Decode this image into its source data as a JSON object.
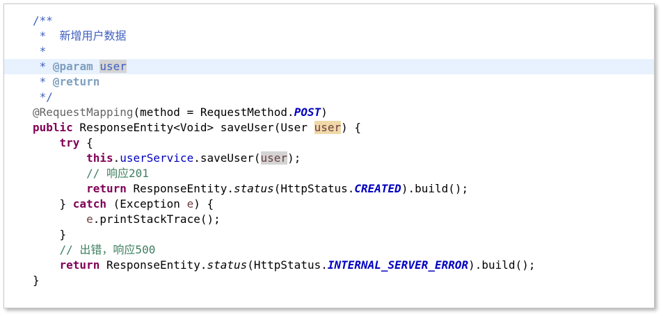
{
  "editor": {
    "lines": [
      {
        "tokens": [
          {
            "t": "/**",
            "c": "jd"
          }
        ]
      },
      {
        "tokens": [
          {
            "t": " *  新增用户数据",
            "c": "jd"
          }
        ]
      },
      {
        "tokens": [
          {
            "t": " *",
            "c": "jd"
          }
        ]
      },
      {
        "current": true,
        "tokens": [
          {
            "t": " * ",
            "c": "jd"
          },
          {
            "t": "@param",
            "c": "jdtag"
          },
          {
            "t": " ",
            "c": "jd"
          },
          {
            "t": "user",
            "c": "jd hl-gray"
          }
        ]
      },
      {
        "tokens": [
          {
            "t": " * ",
            "c": "jd"
          },
          {
            "t": "@return",
            "c": "jdtag"
          }
        ]
      },
      {
        "tokens": [
          {
            "t": " */",
            "c": "jd"
          }
        ]
      },
      {
        "tokens": [
          {
            "t": "@RequestMapping",
            "c": "ann"
          },
          {
            "t": "(method = RequestMethod.",
            "c": ""
          },
          {
            "t": "POST",
            "c": "cst"
          },
          {
            "t": ")",
            "c": ""
          }
        ]
      },
      {
        "tokens": [
          {
            "t": "public",
            "c": "kw"
          },
          {
            "t": " ResponseEntity<Void> saveUser(User ",
            "c": ""
          },
          {
            "t": "user",
            "c": "var hl-orange"
          },
          {
            "t": ") {",
            "c": ""
          }
        ]
      },
      {
        "tokens": [
          {
            "t": "    ",
            "c": ""
          },
          {
            "t": "try",
            "c": "kw"
          },
          {
            "t": " {",
            "c": ""
          }
        ]
      },
      {
        "tokens": [
          {
            "t": "        ",
            "c": ""
          },
          {
            "t": "this",
            "c": "kw"
          },
          {
            "t": ".",
            "c": ""
          },
          {
            "t": "userService",
            "c": "fld"
          },
          {
            "t": ".saveUser(",
            "c": ""
          },
          {
            "t": "user",
            "c": "var hl-gray"
          },
          {
            "t": ");",
            "c": ""
          }
        ]
      },
      {
        "tokens": [
          {
            "t": "        ",
            "c": ""
          },
          {
            "t": "// 响应201",
            "c": "cm"
          }
        ]
      },
      {
        "tokens": [
          {
            "t": "        ",
            "c": ""
          },
          {
            "t": "return",
            "c": "kw"
          },
          {
            "t": " ResponseEntity.",
            "c": ""
          },
          {
            "t": "status",
            "c": "st"
          },
          {
            "t": "(HttpStatus.",
            "c": ""
          },
          {
            "t": "CREATED",
            "c": "cst"
          },
          {
            "t": ").build();",
            "c": ""
          }
        ]
      },
      {
        "tokens": [
          {
            "t": "    } ",
            "c": ""
          },
          {
            "t": "catch",
            "c": "kw"
          },
          {
            "t": " (Exception ",
            "c": ""
          },
          {
            "t": "e",
            "c": "var"
          },
          {
            "t": ") {",
            "c": ""
          }
        ]
      },
      {
        "tokens": [
          {
            "t": "        ",
            "c": ""
          },
          {
            "t": "e",
            "c": "var"
          },
          {
            "t": ".printStackTrace();",
            "c": ""
          }
        ]
      },
      {
        "tokens": [
          {
            "t": "    }",
            "c": ""
          }
        ]
      },
      {
        "tokens": [
          {
            "t": "    ",
            "c": ""
          },
          {
            "t": "// 出错，响应500",
            "c": "cm"
          }
        ]
      },
      {
        "tokens": [
          {
            "t": "    ",
            "c": ""
          },
          {
            "t": "return",
            "c": "kw"
          },
          {
            "t": " ResponseEntity.",
            "c": ""
          },
          {
            "t": "status",
            "c": "st"
          },
          {
            "t": "(HttpStatus.",
            "c": ""
          },
          {
            "t": "INTERNAL_SERVER_ERROR",
            "c": "cst"
          },
          {
            "t": ").build();",
            "c": ""
          }
        ]
      },
      {
        "tokens": [
          {
            "t": "}",
            "c": ""
          }
        ]
      }
    ]
  },
  "colors": {
    "keyword": "#7f0055",
    "javadoc": "#3f5fbf",
    "javadoc_tag": "#7f9fbf",
    "comment": "#3f7f5f",
    "annotation": "#646464",
    "field_constant": "#0000c0",
    "local_variable": "#6a3e3e",
    "current_line": "#e8f2fe",
    "occurrence_highlight": "#d4d4d4",
    "selection_highlight": "#f0d8a8"
  }
}
